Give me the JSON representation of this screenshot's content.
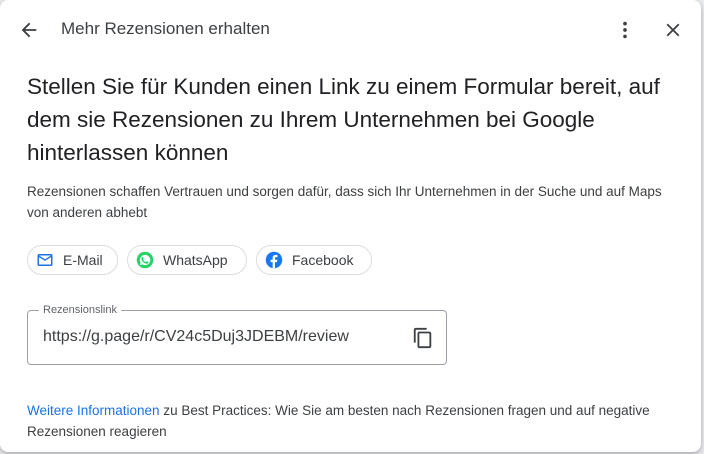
{
  "header": {
    "title": "Mehr Rezensionen erhalten",
    "back_icon": "arrow-back-icon",
    "more_icon": "more-vert-icon",
    "close_icon": "close-icon"
  },
  "main": {
    "headline": "Stellen Sie für Kunden einen Link zu einem Formular bereit, auf dem sie Rezensionen zu Ihrem Unternehmen bei Google hinterlassen können",
    "description": "Rezensionen schaffen Vertrauen und sorgen dafür, dass sich Ihr Unternehmen in der Suche und auf Maps von anderen abhebt",
    "share_options": [
      {
        "label": "E-Mail",
        "icon": "email-icon",
        "color": "#1a73e8"
      },
      {
        "label": "WhatsApp",
        "icon": "whatsapp-icon",
        "color": "#25d366"
      },
      {
        "label": "Facebook",
        "icon": "facebook-icon",
        "color": "#1877f2"
      }
    ],
    "review_link": {
      "label": "Rezensionslink",
      "value": "https://g.page/r/CV24c5Duj3JDEBM/review",
      "copy_icon": "copy-icon"
    },
    "footer": {
      "link_text": "Weitere Informationen",
      "text": " zu Best Practices: Wie Sie am besten nach Rezensionen fragen und auf negative Rezensionen reagieren"
    }
  },
  "colors": {
    "accent": "#1a73e8",
    "text_primary": "#202124",
    "text_secondary": "#3c4043"
  }
}
